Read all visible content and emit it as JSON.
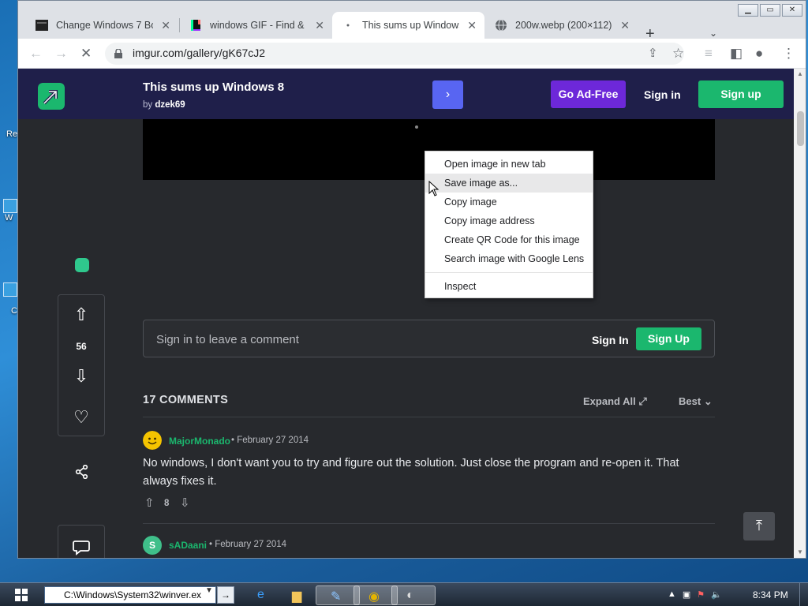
{
  "desktop": {
    "fragments": [
      "Re",
      "W",
      "C"
    ]
  },
  "window_controls": {
    "minimize": "▁",
    "maximize": "▭",
    "close": "✕"
  },
  "tabs": [
    {
      "title": "Change Windows 7 Boo",
      "close": "✕"
    },
    {
      "title": "windows GIF - Find & St",
      "close": "✕"
    },
    {
      "title": "This sums up Windows",
      "close": "✕"
    },
    {
      "title": "200w.webp (200×112)",
      "close": "✕"
    }
  ],
  "tabstrip": {
    "new_tab": "+",
    "tab_search": "⌄"
  },
  "toolbar": {
    "url": "imgur.com/gallery/gK67cJ2"
  },
  "header": {
    "post_title": "This sums up Windows 8",
    "by_prefix": "by ",
    "author": "dzek69",
    "next_icon": "›",
    "go_ad_free": "Go Ad-Free",
    "sign_in": "Sign in",
    "sign_up": "Sign up"
  },
  "sidebar": {
    "vote_count": "56"
  },
  "comment_input": {
    "placeholder": "Sign in to leave a comment",
    "sign_in": "Sign In",
    "sign_up": "Sign Up"
  },
  "comments_header": {
    "count_label": "17 COMMENTS",
    "expand_all": "Expand All",
    "sort": "Best"
  },
  "comments": [
    {
      "author": "MajorMonado",
      "date": "February 27 2014",
      "text": "No windows, I don't want you to try and figure out the solution. Just close the program and re-open it. That always fixes it.",
      "score": "8"
    },
    {
      "author": "sADaani",
      "date": "February 27 2014",
      "avatar_letter": "S"
    }
  ],
  "context_menu": {
    "items": [
      "Open image in new tab",
      "Save image as...",
      "Copy image",
      "Copy image address",
      "Create QR Code for this image",
      "Search image with Google Lens"
    ],
    "inspect": "Inspect",
    "hovered_index": 1
  },
  "taskbar": {
    "run_path": "C:\\Windows\\System32\\winver.ex",
    "run_go": "→",
    "clock": "8:34 PM"
  },
  "colors": {
    "accent_green": "#1bb76e",
    "header_bg": "#1f1f4a",
    "ad_free_purple": "#6d28d9",
    "next_blue": "#5865f2",
    "page_bg": "#27292d"
  }
}
